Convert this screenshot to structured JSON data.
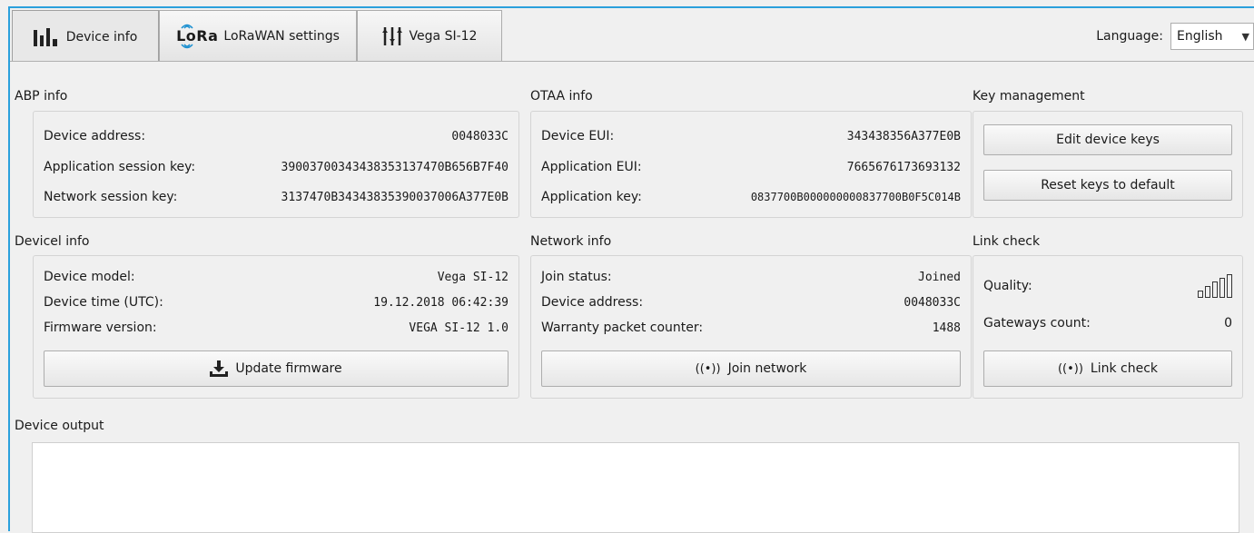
{
  "tabs": [
    {
      "label": "Device info",
      "icon": "bar-chart-icon"
    },
    {
      "label": "LoRaWAN settings",
      "icon_text": "LoRa"
    },
    {
      "label": "Vega SI-12",
      "icon": "sliders-icon"
    }
  ],
  "language": {
    "label": "Language:",
    "value": "English"
  },
  "abp": {
    "title": "ABP info",
    "rows": [
      {
        "label": "Device address:",
        "value": "0048033C"
      },
      {
        "label": "Application session key:",
        "value": "39003700343438353137470B656B7F40"
      },
      {
        "label": "Network session key:",
        "value": "3137470B34343835390037006A377E0B"
      }
    ]
  },
  "otaa": {
    "title": "OTAA info",
    "rows": [
      {
        "label": "Device EUI:",
        "value": "343438356A377E0B"
      },
      {
        "label": "Application EUI:",
        "value": "7665676173693132"
      },
      {
        "label": "Application key:",
        "value": "0837700B000000000837700B0F5C014B"
      }
    ]
  },
  "keys": {
    "title": "Key management",
    "edit_label": "Edit device keys",
    "reset_label": "Reset keys to default"
  },
  "device": {
    "title": "Devicel info",
    "rows": [
      {
        "label": "Device model:",
        "value": "Vega SI-12"
      },
      {
        "label": "Device time (UTC):",
        "value": "19.12.2018 06:42:39"
      },
      {
        "label": "Firmware version:",
        "value": "VEGA SI-12 1.0"
      }
    ],
    "update_label": "Update firmware"
  },
  "network": {
    "title": "Network info",
    "rows": [
      {
        "label": "Join status:",
        "value": "Joined"
      },
      {
        "label": "Device address:",
        "value": "0048033C"
      },
      {
        "label": "Warranty packet counter:",
        "value": "1488"
      }
    ],
    "join_label": "Join network"
  },
  "link": {
    "title": "Link check",
    "quality_label": "Quality:",
    "gateways_label": "Gateways count:",
    "gateways_value": "0",
    "button_label": "Link check",
    "signal_icon": "signal-bars-icon"
  },
  "output": {
    "title": "Device output"
  }
}
